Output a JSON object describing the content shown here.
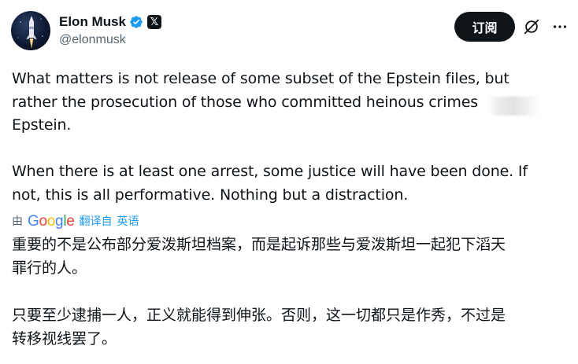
{
  "author": {
    "display_name": "Elon Musk",
    "handle": "@elonmusk",
    "verified_icon": "verified-badge-icon",
    "affiliate_badge": "𝕏"
  },
  "actions": {
    "subscribe_label": "订阅",
    "grok_icon": "grok-icon",
    "more_icon": "more-options-icon"
  },
  "tweet": {
    "paragraphs": [
      "What matters is not release of some subset of the Epstein files, but\nrather the prosecution of those who committed heinous crimes\nEpstein.",
      "When there is at least one arrest, some justice will have been done. If\nnot, this is all performative. Nothing but a distraction."
    ]
  },
  "translation": {
    "by_label": "由",
    "provider": "Google",
    "link_label": "翻译自",
    "source_language": "英语",
    "paragraphs": [
      "重要的不是公布部分爱泼斯坦档案，而是起诉那些与爱泼斯坦一起犯下滔天\n罪行的人。",
      "只要至少逮捕一人，正义就能得到伸张。否则，这一切都只是作秀，不过是\n转移视线罢了。"
    ]
  },
  "colors": {
    "text_primary": "#0f1419",
    "text_secondary": "#536471",
    "link": "#1d9bf0",
    "verified": "#1d9bf0",
    "button_bg": "#0f1419"
  }
}
